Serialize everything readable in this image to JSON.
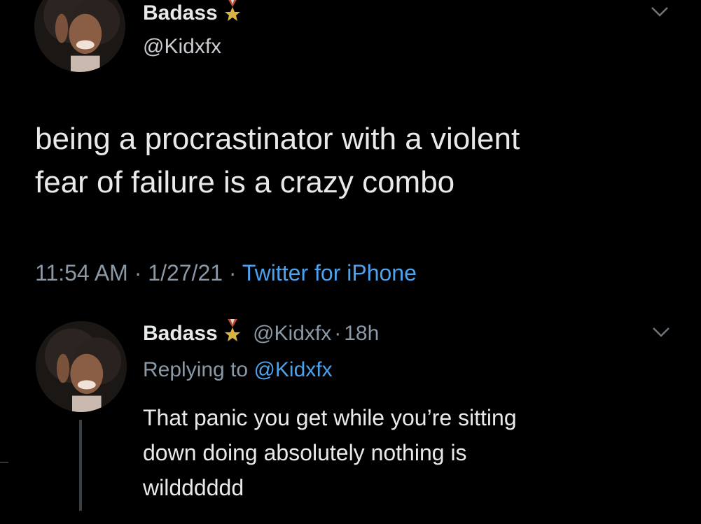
{
  "main_tweet": {
    "name": "Badass",
    "handle": "@Kidxfx",
    "text_line1": "being a procrastinator with a violent",
    "text_line2": "fear of failure is a crazy combo",
    "time": "11:54 AM",
    "date": "1/27/21",
    "separator": "·",
    "source": "Twitter for iPhone",
    "badge_icon": "medal-icon",
    "menu_icon": "chevron-down-icon"
  },
  "reply": {
    "name": "Badass",
    "handle": "@Kidxfx",
    "separator": "·",
    "age": "18h",
    "replying_prefix": "Replying to",
    "replying_handle": "@Kidxfx",
    "text_line1": "That panic you get while you’re sitting",
    "text_line2": "down doing absolutely nothing is",
    "text_line3": "wildddddd",
    "badge_icon": "medal-icon",
    "menu_icon": "chevron-down-icon"
  },
  "colors": {
    "background": "#000000",
    "text": "#e7e9ea",
    "secondary": "#8b98a5",
    "link": "#4aa3f0"
  }
}
